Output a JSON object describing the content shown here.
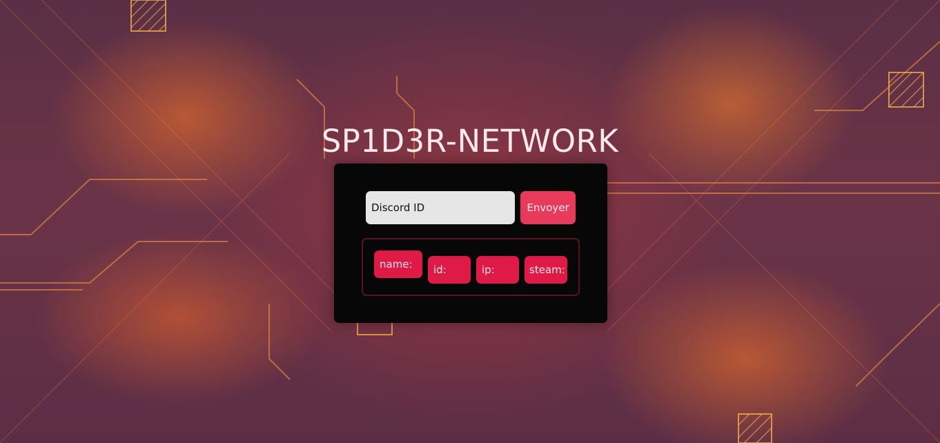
{
  "page": {
    "title": "SP1D3R-NETWORK"
  },
  "lookup": {
    "input_value": "Discord ID",
    "submit_label": "Envoyer"
  },
  "results": {
    "name_label": "name:",
    "id_label": "id:",
    "ip_label": "ip:",
    "steam_label": "steam:"
  },
  "colors": {
    "card_background": "#070707",
    "accent": "#e01a47",
    "button": "#e83b5c",
    "input_background": "#e6e6e6",
    "title_text": "#fbe9ee"
  }
}
